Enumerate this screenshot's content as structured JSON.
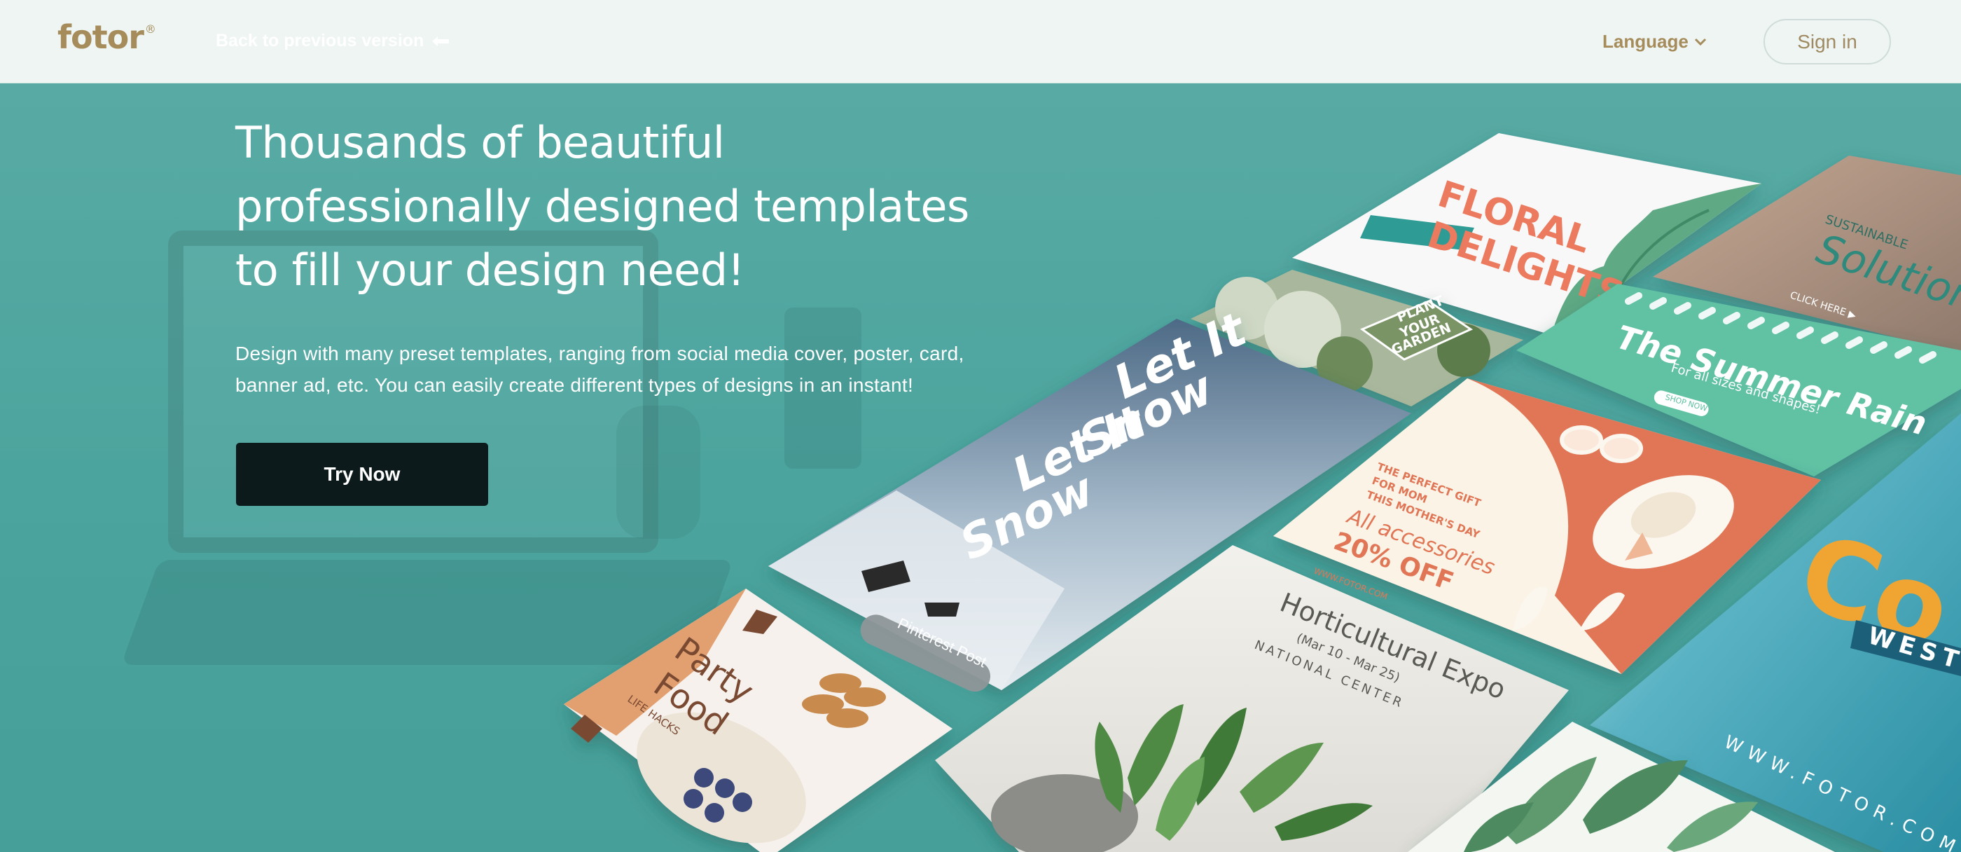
{
  "header": {
    "logo_text": "fotor",
    "logo_mark": "®",
    "back_link": "Back to previous version",
    "language_label": "Language",
    "signin_label": "Sign in"
  },
  "hero": {
    "headline": "Thousands of beautiful professionally designed templates to fill your design need!",
    "subtext": "Design with many preset templates, ranging from social media cover, poster, card, banner ad, etc. You can easily create different types of designs in an instant!",
    "cta_label": "Try Now"
  },
  "templates": {
    "floral": {
      "line1": "FLORAL",
      "line2": "DELIGHTS"
    },
    "sustainable": {
      "small": "SUSTAINABLE",
      "script": "Solution",
      "cta": "CLICK HERE ▶"
    },
    "garden": {
      "line1": "PLANT",
      "line2": "YOUR",
      "line3": "GARDEN"
    },
    "summer": {
      "script": "The Summer Rain",
      "sub": "For all sizes and shapes!",
      "btn": "SHOP NOW"
    },
    "snow": {
      "line1": "Let It",
      "line2": "Snow",
      "line3": "Let It",
      "line4": "Snow"
    },
    "pin_badge": "Pinterest Post",
    "mothers": {
      "l1": "THE PERFECT GIFT",
      "l2": "FOR MOM",
      "l3": "THIS MOTHER'S DAY",
      "l4": "All accessories",
      "l5": "20% OFF",
      "url": "WWW.FOTOR.COM"
    },
    "coast": {
      "big": "Co",
      "band": "WEST",
      "url": "WWW.FOTOR.COM"
    },
    "party": {
      "l1": "Party",
      "l2": "Food",
      "l3": "LIFE HACKS"
    },
    "expo": {
      "title": "Horticultural Expo",
      "dates": "(Mar 10 - Mar 25)",
      "venue": "NATIONAL CENTER"
    }
  },
  "colors": {
    "hero_bg": "#4ea7a1",
    "header_bg": "#eef5f3",
    "brand_gold": "#a68c5b",
    "cta_bg": "#0c1a1b",
    "coral": "#e9735a",
    "teal_card": "#5fc0a2"
  }
}
